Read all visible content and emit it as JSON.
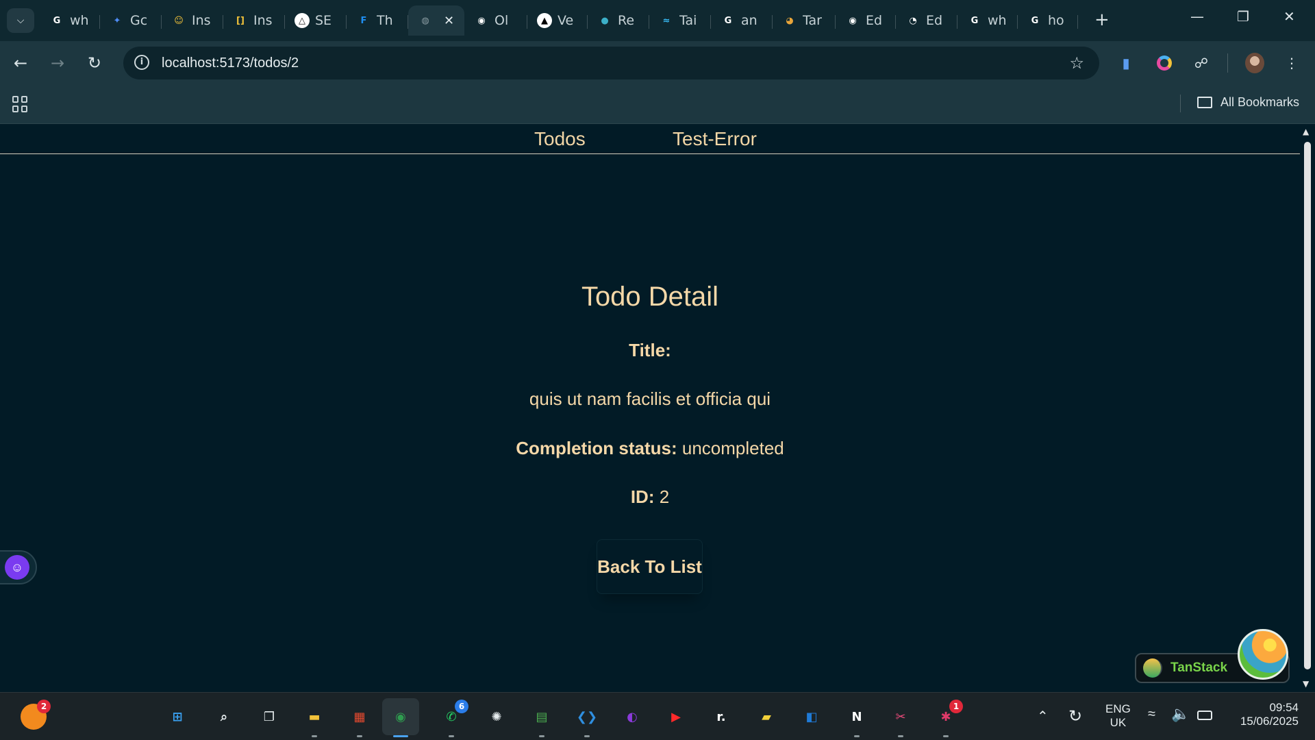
{
  "browser": {
    "tabs": [
      {
        "label": "wh",
        "icon": "google-icon",
        "color": "#ffffff",
        "glyph": "G"
      },
      {
        "label": "Gc",
        "icon": "gemini-icon",
        "color": "#4f8df7",
        "glyph": "✦"
      },
      {
        "label": "Ins",
        "icon": "emoji-face-icon",
        "color": "#f2c23a",
        "glyph": "☺"
      },
      {
        "label": "Ins",
        "icon": "bracket-icon",
        "color": "#f2c23a",
        "glyph": "[]"
      },
      {
        "label": "SE",
        "icon": "triangle-icon",
        "color": "#1b1b1b",
        "glyph": "△"
      },
      {
        "label": "Th",
        "icon": "framer-f-icon",
        "color": "#1f8ef1",
        "glyph": "F"
      },
      {
        "label": "",
        "icon": "globe-icon",
        "color": "#8a9ca2",
        "glyph": "◍"
      },
      {
        "label": "Ol",
        "icon": "github-icon",
        "color": "#ffffff",
        "glyph": "◉"
      },
      {
        "label": "Ve",
        "icon": "vercel-icon",
        "color": "#000000",
        "glyph": "▲"
      },
      {
        "label": "Re",
        "icon": "render-icon",
        "color": "#3cb0c8",
        "glyph": "●"
      },
      {
        "label": "Tai",
        "icon": "tailwind-icon",
        "color": "#38bdf8",
        "glyph": "≈"
      },
      {
        "label": "an",
        "icon": "google-icon",
        "color": "#ffffff",
        "glyph": "G"
      },
      {
        "label": "Tar",
        "icon": "tanstack-icon",
        "color": "#e8a53a",
        "glyph": "◕"
      },
      {
        "label": "Ed",
        "icon": "github-icon",
        "color": "#ffffff",
        "glyph": "◉"
      },
      {
        "label": "Ed",
        "icon": "copilot-icon",
        "color": "#ffffff",
        "glyph": "◔"
      },
      {
        "label": "wh",
        "icon": "google-icon",
        "color": "#ffffff",
        "glyph": "G"
      },
      {
        "label": "ho",
        "icon": "google-icon",
        "color": "#ffffff",
        "glyph": "G"
      }
    ],
    "url": "localhost:5173/todos/2",
    "all_bookmarks": "All Bookmarks"
  },
  "nav": {
    "todos": "Todos",
    "test_error": "Test-Error"
  },
  "detail": {
    "heading": "Todo Detail",
    "title_label": "Title:",
    "title_value": "quis ut nam facilis et officia qui",
    "status_label": "Completion status:",
    "status_value": "uncompleted",
    "id_label": "ID:",
    "id_value": "2",
    "back_button": "Back To List"
  },
  "devtools": {
    "tanstack_label": "TanStack"
  },
  "taskbar": {
    "apps": [
      {
        "name": "windows-start-icon",
        "glyph": "⊞",
        "color": "#3aa0f0"
      },
      {
        "name": "search-icon",
        "glyph": "⌕",
        "color": "#e6ecee"
      },
      {
        "name": "task-view-icon",
        "glyph": "❐",
        "color": "#e6ecee"
      },
      {
        "name": "file-explorer-icon",
        "glyph": "▬",
        "color": "#f2c23a"
      },
      {
        "name": "ms-store-icon",
        "glyph": "▦",
        "color": "#e84a2f"
      },
      {
        "name": "chrome-icon",
        "glyph": "◉",
        "color": "#2f9c4f",
        "active": true
      },
      {
        "name": "whatsapp-icon",
        "glyph": "✆",
        "color": "#25d366",
        "badge": "6"
      },
      {
        "name": "chatgpt-icon",
        "glyph": "✺",
        "color": "#e6ecee"
      },
      {
        "name": "excel-like-icon",
        "glyph": "▤",
        "color": "#4caf50"
      },
      {
        "name": "vscode-icon",
        "glyph": "❮❯",
        "color": "#2f8fe0"
      },
      {
        "name": "app-purple-icon",
        "glyph": "◐",
        "color": "#8a3ad9"
      },
      {
        "name": "youtube-icon",
        "glyph": "▶",
        "color": "#ff2a2a"
      },
      {
        "name": "r-app-icon",
        "glyph": "r.",
        "color": "#ffffff"
      },
      {
        "name": "sticky-notes-icon",
        "glyph": "▰",
        "color": "#f2d13a"
      },
      {
        "name": "blue-app-icon",
        "glyph": "◧",
        "color": "#1f7ad6"
      },
      {
        "name": "notion-icon",
        "glyph": "N",
        "color": "#ffffff"
      },
      {
        "name": "snipping-tool-icon",
        "glyph": "✂",
        "color": "#e84a7a"
      },
      {
        "name": "slack-icon",
        "glyph": "✱",
        "color": "#e03a6a",
        "badge": "1"
      }
    ],
    "widgets_badge": "2",
    "lang_top": "ENG",
    "lang_bottom": "UK",
    "time": "09:54",
    "date": "15/06/2025"
  }
}
